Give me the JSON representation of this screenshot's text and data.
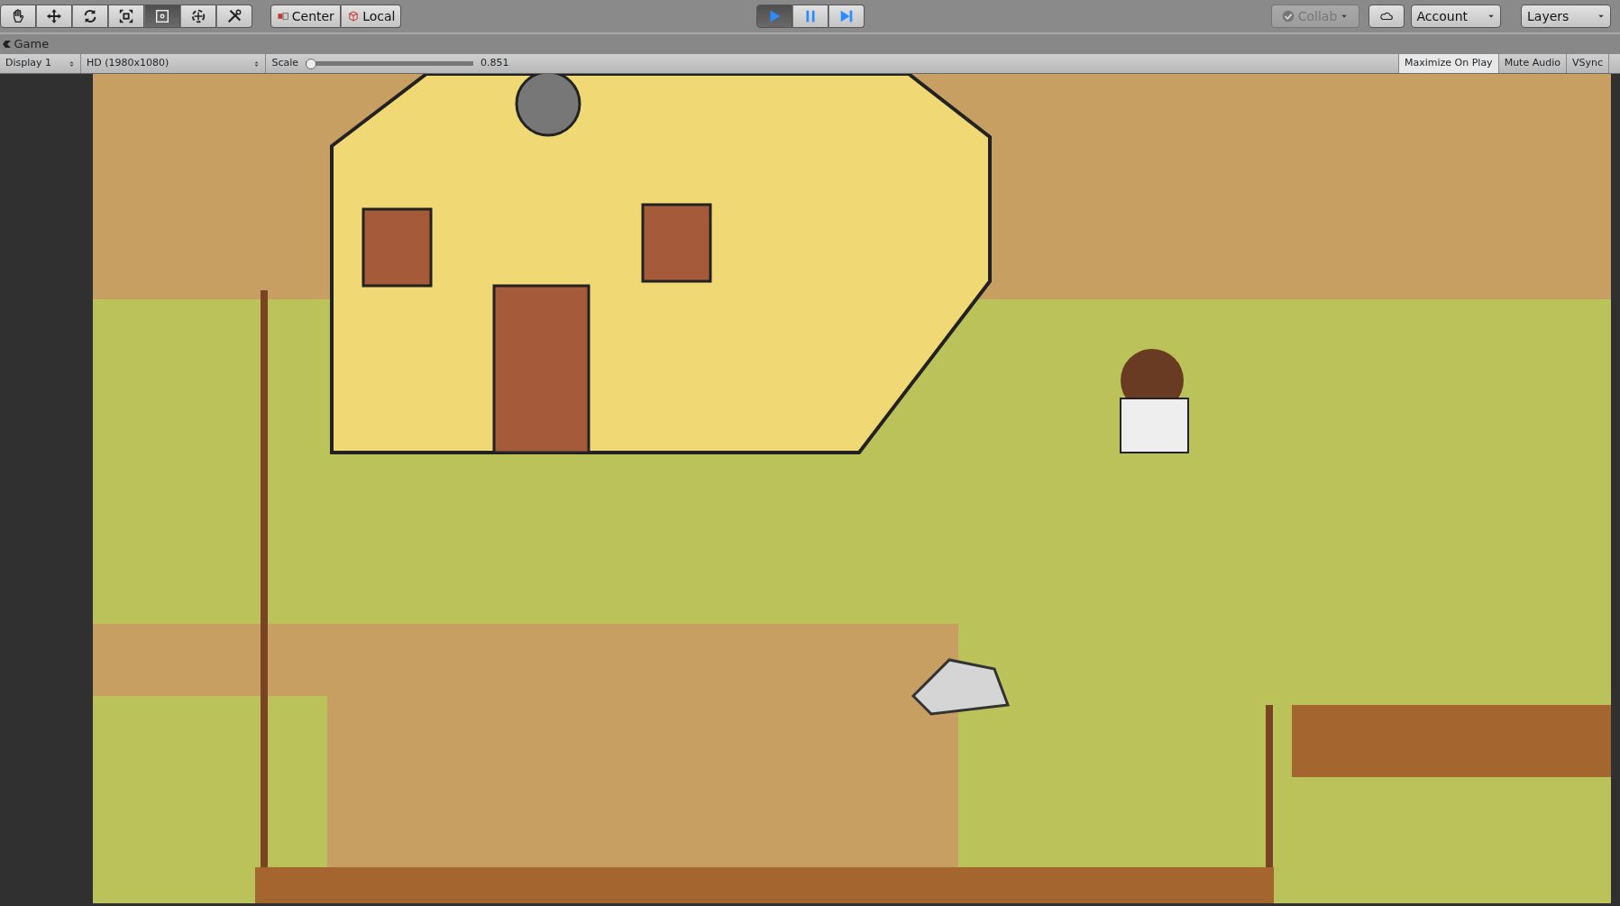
{
  "toolbar": {
    "tools": [
      {
        "kind": "hand",
        "selected": false
      },
      {
        "kind": "move",
        "selected": false
      },
      {
        "kind": "rotate",
        "selected": false
      },
      {
        "kind": "scale",
        "selected": false
      },
      {
        "kind": "rect",
        "selected": true
      },
      {
        "kind": "transform",
        "selected": false
      },
      {
        "kind": "custom",
        "selected": false
      }
    ],
    "pivot": [
      {
        "kind": "center",
        "label": "Center"
      },
      {
        "kind": "local",
        "label": "Local"
      }
    ],
    "playback": [
      {
        "kind": "play",
        "selected": true
      },
      {
        "kind": "pause",
        "selected": false
      },
      {
        "kind": "step",
        "selected": false
      }
    ],
    "collab": {
      "label": "Collab",
      "disabled": true
    },
    "account": {
      "label": "Account"
    },
    "layers": {
      "label": "Layers"
    }
  },
  "game_view": {
    "tab_title": "Game",
    "display": "Display 1",
    "resolution": "HD (1980x1080)",
    "scale_label": "Scale",
    "scale": {
      "level": 0
    },
    "scale_value": "0.851",
    "toggles": [
      {
        "label": "Maximize On Play",
        "on": true
      },
      {
        "label": "Mute Audio",
        "on": false
      },
      {
        "label": "VSync",
        "on": false
      }
    ]
  }
}
